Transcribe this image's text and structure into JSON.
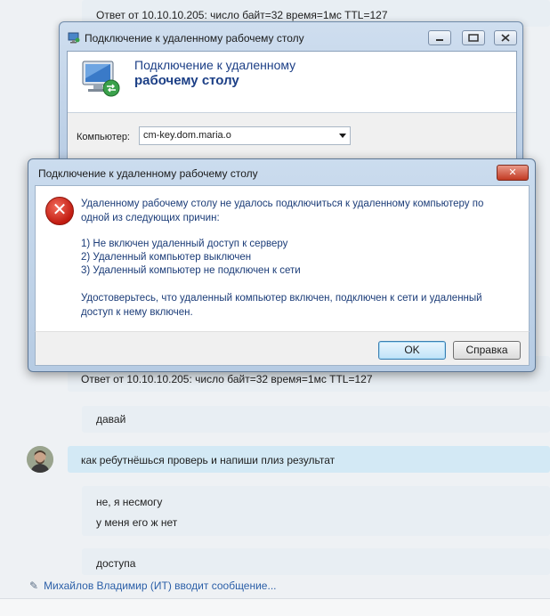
{
  "chat": {
    "ping_top": "Ответ от 10.10.10.205: число байт=32 время=1мс TTL=127",
    "ping_bottom": "Ответ от 10.10.10.205: число байт=32 время=1мс TTL=127",
    "msg_davai": "давай",
    "msg_reboot": "как ребутнёшься проверь и напиши плиз результат",
    "msg_cant_1": "не, я несмогу",
    "msg_cant_2": "у меня его ж нет",
    "msg_access": "доступа",
    "typing_status": "Михайлов Владимир (ИТ) вводит сообщение..."
  },
  "rdp_window": {
    "title": "Подключение к удаленному рабочему столу",
    "header_line1": "Подключение к удаленному",
    "header_line2": "рабочему столу",
    "computer_label": "Компьютер:",
    "computer_value": "cm-key.dom.maria.o"
  },
  "error_dialog": {
    "title": "Подключение к удаленному рабочему столу",
    "close_label": "✕",
    "line1": "Удаленному рабочему столу не удалось подключиться к удаленному компьютеру по",
    "line2": "одной из следующих причин:",
    "reason1": "1) Не включен удаленный доступ к серверу",
    "reason2": "2) Удаленный компьютер выключен",
    "reason3": "3) Удаленный компьютер не подключен к сети",
    "line3": "Удостоверьтесь, что удаленный компьютер включен, подключен к сети и удаленный",
    "line4": "доступ к нему включен.",
    "ok_label": "OK",
    "help_label": "Справка"
  },
  "colors": {
    "chat_bg": "#eef1f4",
    "bubble_blue": "#d3e9f5",
    "bubble_light": "#e8eef3",
    "link": "#2b5fa8",
    "dialog_text": "#1b3c78",
    "error_red": "#c11b10"
  }
}
